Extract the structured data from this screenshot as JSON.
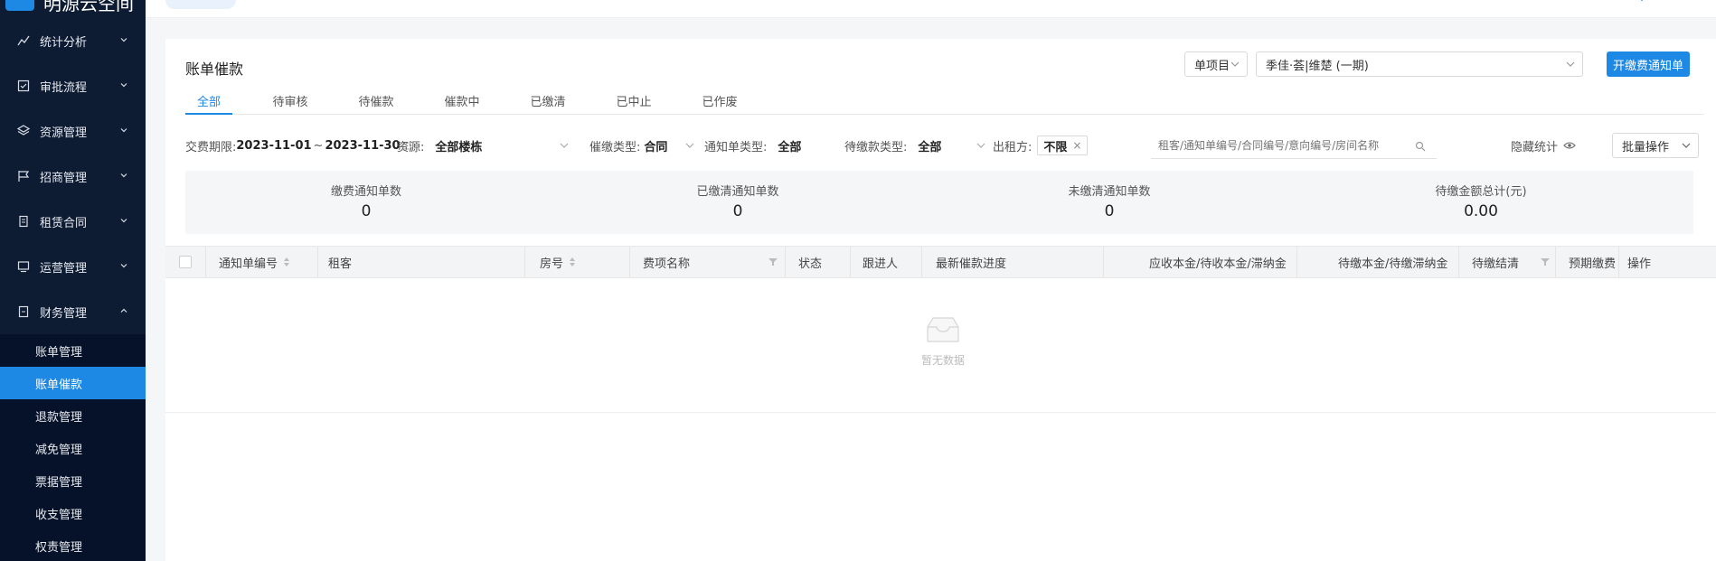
{
  "brand": {
    "name": "明源云空间"
  },
  "sidebar": {
    "items": [
      {
        "label": "统计分析",
        "icon": "chart-icon"
      },
      {
        "label": "审批流程",
        "icon": "approval-icon"
      },
      {
        "label": "资源管理",
        "icon": "layers-icon"
      },
      {
        "label": "招商管理",
        "icon": "flag-icon"
      },
      {
        "label": "租赁合同",
        "icon": "contract-icon"
      },
      {
        "label": "运营管理",
        "icon": "monitor-icon"
      },
      {
        "label": "财务管理",
        "icon": "finance-icon"
      }
    ],
    "sub_items": [
      {
        "label": "账单管理"
      },
      {
        "label": "账单催款"
      },
      {
        "label": "退款管理"
      },
      {
        "label": "减免管理"
      },
      {
        "label": "票据管理"
      },
      {
        "label": "收支管理"
      },
      {
        "label": "权责管理"
      }
    ]
  },
  "page": {
    "title": "账单催款",
    "project_mode": "单项目",
    "project_select": "季佳·荟|维楚 (一期)",
    "primary_button": "开缴费通知单"
  },
  "tabs": [
    {
      "label": "全部"
    },
    {
      "label": "待审核"
    },
    {
      "label": "待催款"
    },
    {
      "label": "催款中"
    },
    {
      "label": "已缴清"
    },
    {
      "label": "已中止"
    },
    {
      "label": "已作废"
    }
  ],
  "filters": {
    "period_label": "交费期限:",
    "period_start": "2023-11-01",
    "period_sep": "~",
    "period_end": "2023-11-30",
    "resource_label": "资源:",
    "resource_value": "全部楼栋",
    "urge_type_label": "催缴类型:",
    "urge_type_value": "合同",
    "notice_type_label": "通知单类型:",
    "notice_type_value": "全部",
    "pending_type_label": "待缴款类型:",
    "pending_type_value": "全部",
    "lessor_label": "出租方:",
    "lessor_value": "不限",
    "tag_close": "×",
    "search_placeholder": "租客/通知单编号/合同编号/意向编号/房间名称",
    "hide_stats": "隐藏统计",
    "batch_ops": "批量操作"
  },
  "stats": [
    {
      "label": "缴费通知单数",
      "value": "0"
    },
    {
      "label": "已缴清通知单数",
      "value": "0"
    },
    {
      "label": "未缴清通知单数",
      "value": "0"
    },
    {
      "label": "待缴金额总计(元)",
      "value": "0.00"
    }
  ],
  "table": {
    "columns": [
      "通知单编号",
      "租客",
      "房号",
      "费项名称",
      "状态",
      "跟进人",
      "最新催款进度",
      "应收本金/待收本金/滞纳金",
      "待缴本金/待缴滞纳金",
      "待缴结清",
      "预期缴费",
      "操作"
    ],
    "empty_text": "暂无数据"
  },
  "colors": {
    "accent": "#1e88e5",
    "sidebar_bg": "#0d1b33",
    "sidebar_sub_bg": "#061229"
  }
}
